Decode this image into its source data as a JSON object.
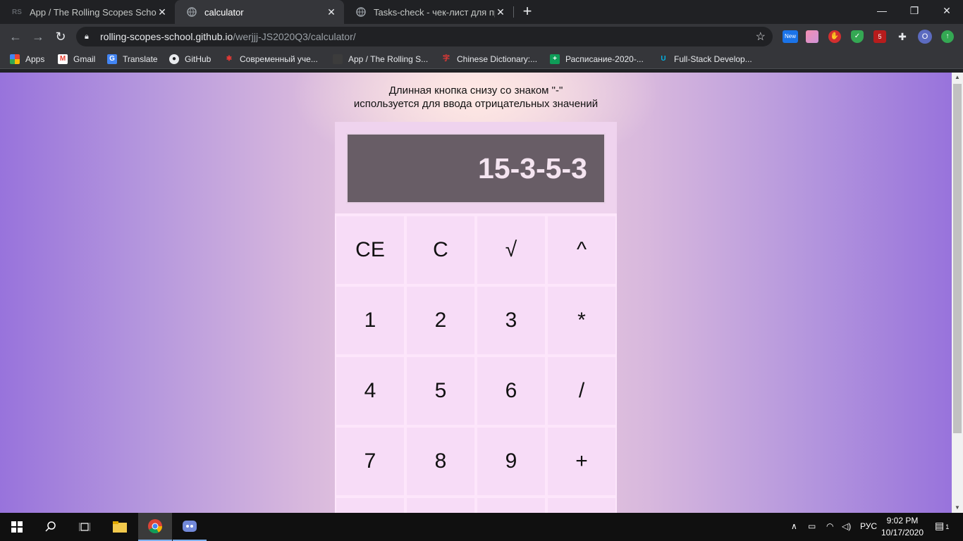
{
  "browser": {
    "tabs": [
      {
        "favicon": "RS",
        "title": "App / The Rolling Scopes School",
        "active": false
      },
      {
        "favicon": "globe-icon",
        "title": "calculator",
        "active": true
      },
      {
        "favicon": "globe-icon",
        "title": "Tasks-check - чек-лист для пров",
        "active": false
      }
    ],
    "new_tab": "+",
    "window_controls": {
      "minimize": "—",
      "restore": "❐",
      "close": "✕"
    },
    "url_host": "rolling-scopes-school.github.io",
    "url_path": "/werjjj-JS2020Q3/calculator/",
    "extensions": {
      "new_badge": "New",
      "count_badge": "5",
      "profile_initial": "O"
    },
    "bookmarks": [
      {
        "icon": "apps-icon",
        "label": "Apps"
      },
      {
        "icon": "gmail-icon",
        "label": "Gmail"
      },
      {
        "icon": "translate-icon",
        "label": "Translate"
      },
      {
        "icon": "github-icon",
        "label": "GitHub"
      },
      {
        "icon": "bookmark-icon",
        "label": "Современный уче..."
      },
      {
        "icon": "rs-icon",
        "label": "App / The Rolling S..."
      },
      {
        "icon": "dictionary-icon",
        "label": "Chinese Dictionary:..."
      },
      {
        "icon": "sheets-icon",
        "label": "Расписание-2020-..."
      },
      {
        "icon": "udacity-icon",
        "label": "Full-Stack Develop..."
      }
    ]
  },
  "page": {
    "hint_line1": "Длинная кнопка снизу со знаком \"-\"",
    "hint_line2": "используется для ввода отрицательных значений",
    "display_value": "15-3-5-3",
    "keys": [
      [
        "CE",
        "C",
        "√",
        "^"
      ],
      [
        "1",
        "2",
        "3",
        "*"
      ],
      [
        "4",
        "5",
        "6",
        "/"
      ],
      [
        "7",
        "8",
        "9",
        "+"
      ]
    ]
  },
  "taskbar": {
    "language": "РУС",
    "time": "9:02 PM",
    "date": "10/17/2020",
    "notification_count": "1"
  },
  "colors": {
    "page_gradient_edge": "#9873dc",
    "page_gradient_center": "#f0d4df",
    "display_bg": "#685d66",
    "key_bg": "#f7dcf7"
  }
}
